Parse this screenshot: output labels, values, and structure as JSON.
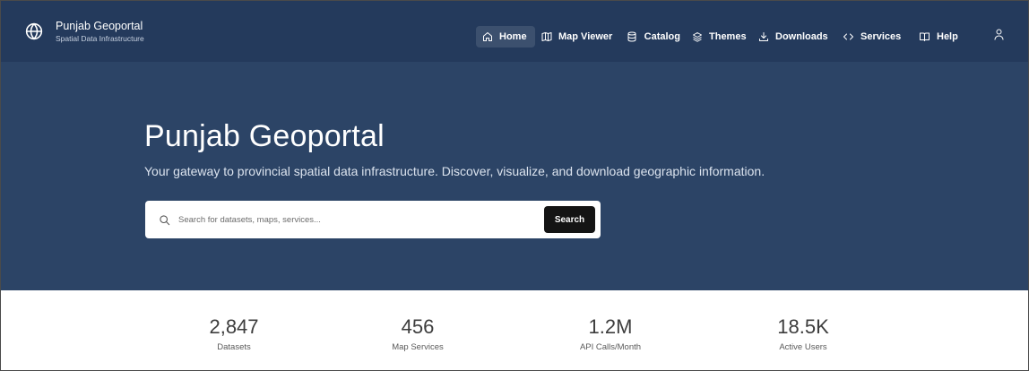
{
  "brand": {
    "title": "Punjab Geoportal",
    "subtitle": "Spatial Data Infrastructure",
    "icon": "globe-icon"
  },
  "nav": {
    "items": [
      {
        "label": "Home",
        "icon": "home-icon",
        "active": true
      },
      {
        "label": "Map Viewer",
        "icon": "map-icon",
        "active": false
      },
      {
        "label": "Catalog",
        "icon": "database-icon",
        "active": false
      },
      {
        "label": "Themes",
        "icon": "layers-icon",
        "active": false
      },
      {
        "label": "Downloads",
        "icon": "download-icon",
        "active": false
      },
      {
        "label": "Services",
        "icon": "code-icon",
        "active": false
      },
      {
        "label": "Help",
        "icon": "book-icon",
        "active": false
      }
    ],
    "user_icon": "user-icon"
  },
  "hero": {
    "title": "Punjab Geoportal",
    "subtitle": "Your gateway to provincial spatial data infrastructure. Discover, visualize, and download geographic information.",
    "search": {
      "placeholder": "Search for datasets, maps, services...",
      "value": "",
      "button_label": "Search"
    }
  },
  "stats": [
    {
      "value": "2,847",
      "label": "Datasets"
    },
    {
      "value": "456",
      "label": "Map Services"
    },
    {
      "value": "1.2M",
      "label": "API Calls/Month"
    },
    {
      "value": "18.5K",
      "label": "Active Users"
    }
  ],
  "colors": {
    "header_bg": "#243a5c",
    "hero_bg": "#2c4466",
    "active_nav_bg": "#3c506e",
    "search_button_bg": "#141414"
  }
}
